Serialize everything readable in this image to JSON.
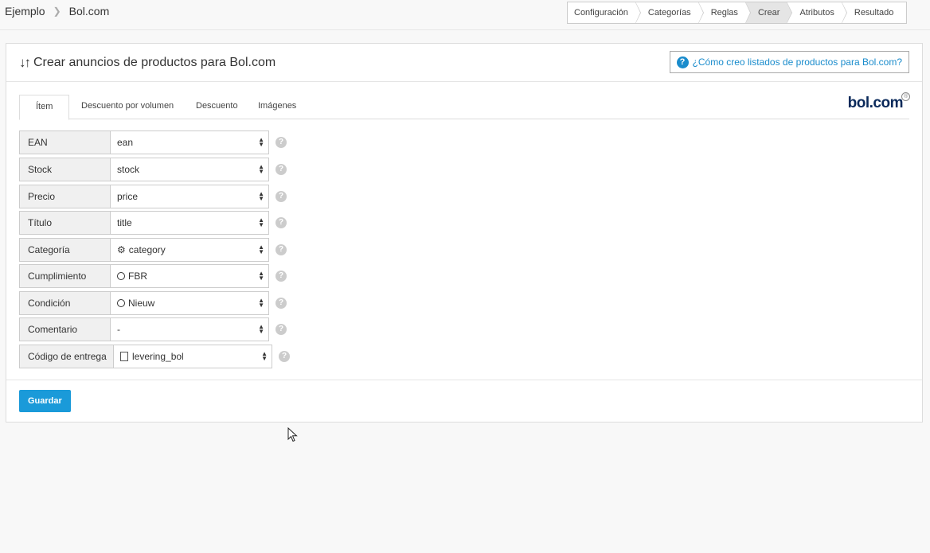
{
  "breadcrumb": {
    "root": "Ejemplo",
    "current": "Bol.com"
  },
  "steps": [
    {
      "label": "Configuración",
      "active": false
    },
    {
      "label": "Categorías",
      "active": false
    },
    {
      "label": "Reglas",
      "active": false
    },
    {
      "label": "Crear",
      "active": true
    },
    {
      "label": "Atributos",
      "active": false
    },
    {
      "label": "Resultado",
      "active": false
    }
  ],
  "panel": {
    "title": "Crear anuncios de productos para Bol.com",
    "help_label": "¿Cómo creo listados de productos para Bol.com?"
  },
  "tabs": [
    {
      "label": "Ítem",
      "active": true
    },
    {
      "label": "Descuento por volumen",
      "active": false
    },
    {
      "label": "Descuento",
      "active": false
    },
    {
      "label": "Imágenes",
      "active": false
    }
  ],
  "logo": {
    "text": "bol.com",
    "mark": "®"
  },
  "fields": [
    {
      "label": "EAN",
      "value": "ean",
      "icon": "none"
    },
    {
      "label": "Stock",
      "value": "stock",
      "icon": "none"
    },
    {
      "label": "Precio",
      "value": "price",
      "icon": "none"
    },
    {
      "label": "Título",
      "value": "title",
      "icon": "none"
    },
    {
      "label": "Categoría",
      "value": "category",
      "icon": "gear-icon"
    },
    {
      "label": "Cumplimiento",
      "value": "FBR",
      "icon": "circle-icon"
    },
    {
      "label": "Condición",
      "value": "Nieuw",
      "icon": "circle-icon"
    },
    {
      "label": "Comentario",
      "value": "-",
      "icon": "none"
    },
    {
      "label": "Código de entrega",
      "value": "levering_bol",
      "icon": "file-icon"
    }
  ],
  "save_label": "Guardar",
  "colors": {
    "accent": "#1a9ad9",
    "link": "#1a8ccc",
    "logo": "#0b2a5b"
  }
}
